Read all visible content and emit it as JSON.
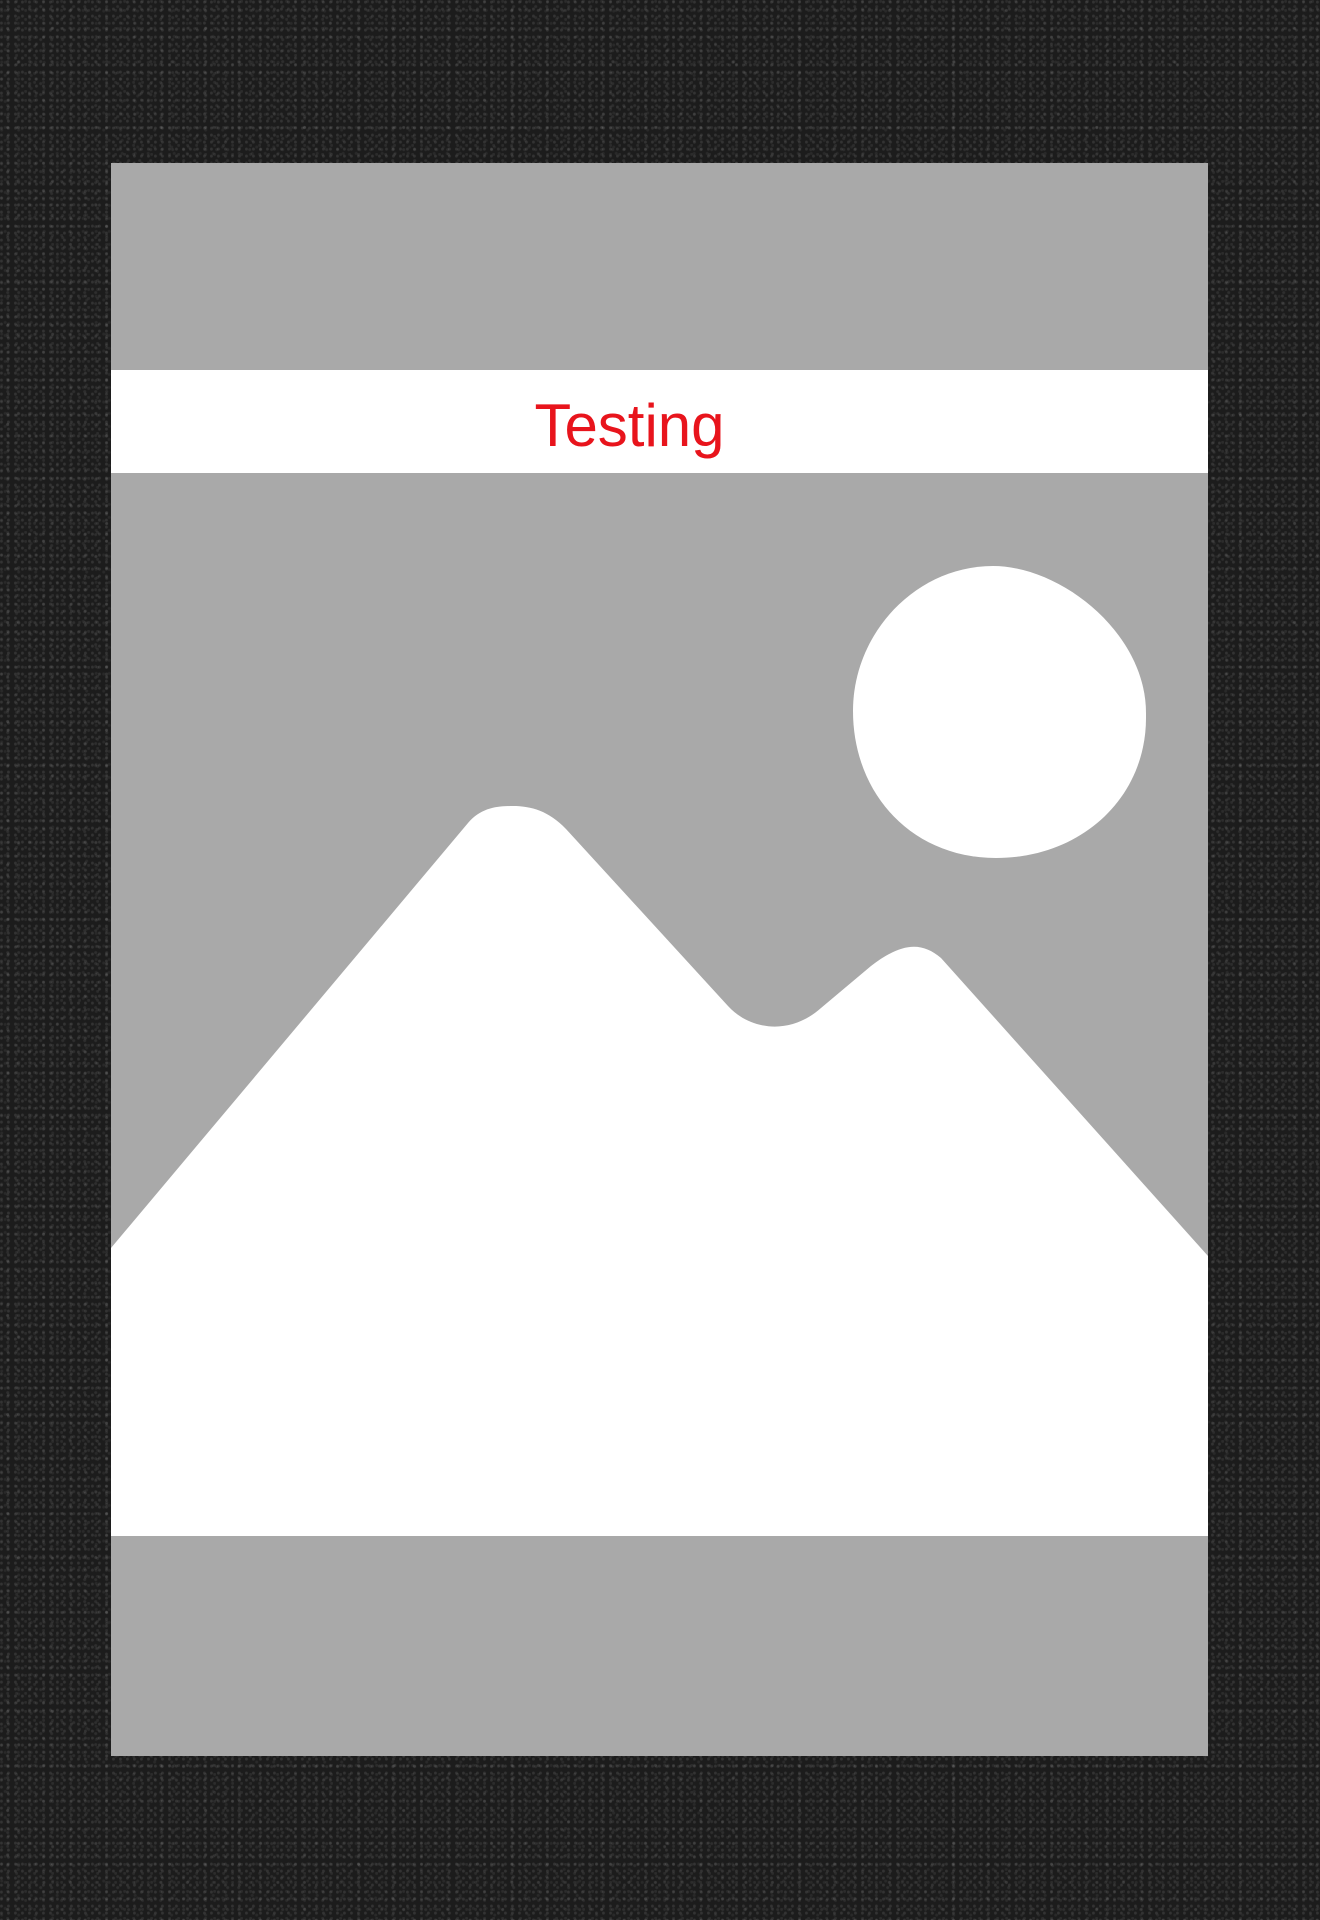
{
  "caption": {
    "text": "Testing"
  },
  "placeholder": {
    "icon": "image-placeholder-icon"
  },
  "colors": {
    "background": "#1c1c1c",
    "panel": "#a9a9a9",
    "band": "#ffffff",
    "caption_text": "#e8141c"
  }
}
